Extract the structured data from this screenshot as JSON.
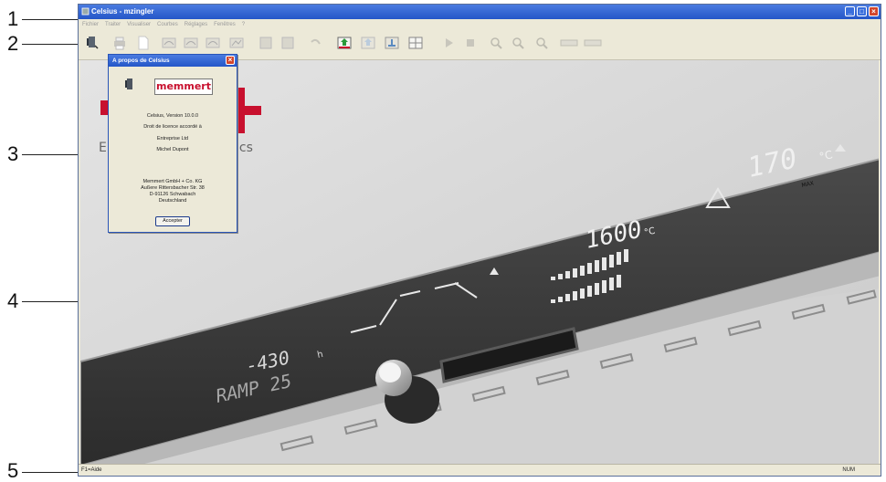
{
  "callouts": [
    "1",
    "2",
    "3",
    "4",
    "5"
  ],
  "window": {
    "title": "Celsius - mzingler",
    "menu": [
      "Fichier",
      "Traiter",
      "Visualiser",
      "Courbes",
      "Réglages",
      "Fenêtres",
      "?"
    ]
  },
  "toolbar": {
    "icons": [
      "celsius-icon",
      "print-icon",
      "new-document-icon",
      "program-icon-1",
      "program-icon-2",
      "program-icon-3",
      "program-icon-4",
      "grid-icon-1",
      "grid-icon-2",
      "undo-icon",
      "transfer-icon",
      "transfer-icon-2",
      "transfer-icon-3",
      "grid-icon-3",
      "play-icon",
      "stop-icon",
      "zoom-in-icon",
      "zoom-out-icon",
      "zoom-icon",
      "view-icon-1",
      "view-icon-2"
    ]
  },
  "background": {
    "brand_tagline_fragment": "E",
    "brand_tagline_suffix": "ics",
    "display": {
      "temp_max": "170",
      "temp_unit": "°C",
      "max_label": "MAX",
      "temp_set": "1600",
      "time": "-430",
      "time_unit": "h",
      "ramp": "RAMP 25"
    }
  },
  "dialog": {
    "title": "A propos de Celsius",
    "logo": "memmert",
    "version": "Celsius, Version 10.0.0",
    "license_line": "Droit de licence accordé à",
    "company": "Entreprise Ltd",
    "user": "Michel Dupont",
    "address": [
      "Memmert GmbH + Co. KG",
      "Außere Rittersbacher Str. 38",
      "D-91126 Schwabach",
      "Deutschland"
    ],
    "accept_label": "Accepter"
  },
  "statusbar": {
    "left": "F1=Aide",
    "right": "NUM"
  },
  "colors": {
    "titlebar": "#2456c8",
    "memmert_red": "#c8102e",
    "panel": "#3e3e3e"
  }
}
